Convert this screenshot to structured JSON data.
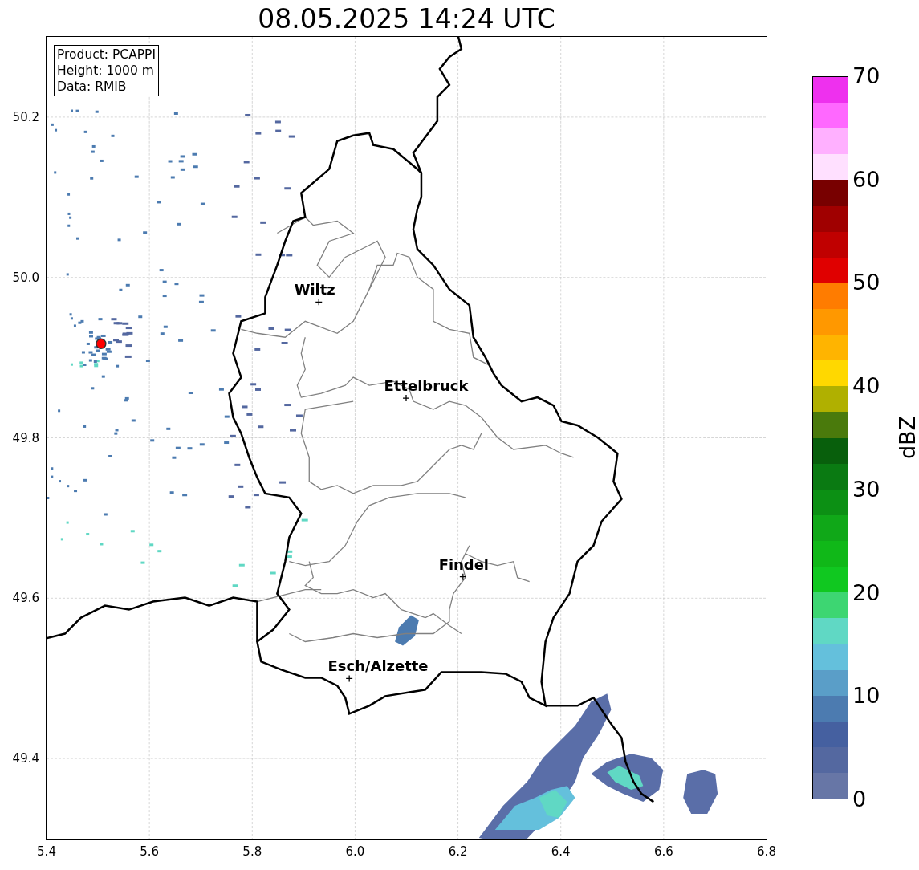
{
  "title": "08.05.2025 14:24 UTC",
  "info_box": [
    "Product: PCAPPI",
    "Height: 1000 m",
    "Data: RMIB"
  ],
  "cities": [
    {
      "name": "Wiltz"
    },
    {
      "name": "Ettelbruck"
    },
    {
      "name": "Findel"
    },
    {
      "name": "Esch/Alzette"
    }
  ],
  "x_axis": {
    "ticks": [
      "5.4",
      "5.6",
      "5.8",
      "6.0",
      "6.2",
      "6.4",
      "6.6",
      "6.8"
    ]
  },
  "y_axis": {
    "ticks": [
      "50.2",
      "50.0",
      "49.8",
      "49.6",
      "49.4"
    ]
  },
  "colorbar": {
    "label": "dBZ",
    "ticks": [
      "70",
      "60",
      "50",
      "40",
      "30",
      "20",
      "10",
      "0"
    ],
    "segments": [
      {
        "color": "#ee30ee"
      },
      {
        "color": "#ff68ff"
      },
      {
        "color": "#ffb0ff"
      },
      {
        "color": "#ffe0ff"
      },
      {
        "color": "#780000"
      },
      {
        "color": "#a00000"
      },
      {
        "color": "#c00000"
      },
      {
        "color": "#e00000"
      },
      {
        "color": "#ff7c00"
      },
      {
        "color": "#ff9800"
      },
      {
        "color": "#ffb400"
      },
      {
        "color": "#ffd800"
      },
      {
        "color": "#b0b000"
      },
      {
        "color": "#4a7a0c"
      },
      {
        "color": "#085f0c"
      },
      {
        "color": "#0a7a12"
      },
      {
        "color": "#0c9014"
      },
      {
        "color": "#10a818"
      },
      {
        "color": "#10b818"
      },
      {
        "color": "#10c820"
      },
      {
        "color": "#3dd672"
      },
      {
        "color": "#60d8c4"
      },
      {
        "color": "#64c0dc"
      },
      {
        "color": "#5a9ec8"
      },
      {
        "color": "#4c7bb0"
      },
      {
        "color": "#4560a0"
      },
      {
        "color": "#5468a0"
      },
      {
        "color": "#6776a6"
      }
    ]
  }
}
